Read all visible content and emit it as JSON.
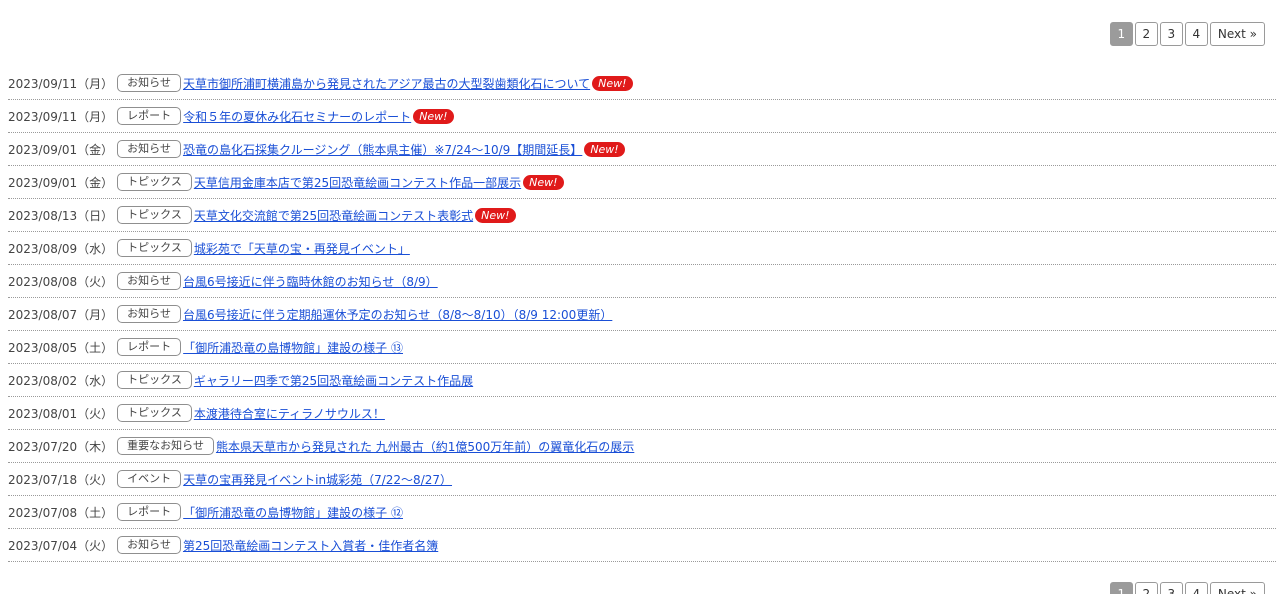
{
  "pagination": {
    "pages": [
      "1",
      "2",
      "3",
      "4"
    ],
    "current": "1",
    "next_label": "Next »"
  },
  "news": [
    {
      "date": "2023/09/11（月）",
      "category": "お知らせ",
      "title": "天草市御所浦町横浦島から発見されたアジア最古の大型裂歯類化石について",
      "is_new": true,
      "new_label": "New!"
    },
    {
      "date": "2023/09/11（月）",
      "category": "レポート",
      "title": "令和５年の夏休み化石セミナーのレポート",
      "is_new": true,
      "new_label": "New!"
    },
    {
      "date": "2023/09/01（金）",
      "category": "お知らせ",
      "title": "恐竜の島化石採集クルージング（熊本県主催）※7/24〜10/9【期間延長】",
      "is_new": true,
      "new_label": "New!"
    },
    {
      "date": "2023/09/01（金）",
      "category": "トピックス",
      "title": "天草信用金庫本店で第25回恐竜絵画コンテスト作品一部展示",
      "is_new": true,
      "new_label": "New!"
    },
    {
      "date": "2023/08/13（日）",
      "category": "トピックス",
      "title": "天草文化交流館で第25回恐竜絵画コンテスト表彰式",
      "is_new": true,
      "new_label": "New!"
    },
    {
      "date": "2023/08/09（水）",
      "category": "トピックス",
      "title": "城彩苑で「天草の宝・再発見イベント」",
      "is_new": false,
      "new_label": ""
    },
    {
      "date": "2023/08/08（火）",
      "category": "お知らせ",
      "title": "台風6号接近に伴う臨時休館のお知らせ（8/9）",
      "is_new": false,
      "new_label": ""
    },
    {
      "date": "2023/08/07（月）",
      "category": "お知らせ",
      "title": "台風6号接近に伴う定期船運休予定のお知らせ（8/8〜8/10）（8/9 12:00更新）",
      "is_new": false,
      "new_label": ""
    },
    {
      "date": "2023/08/05（土）",
      "category": "レポート",
      "title": "「御所浦恐竜の島博物館」建設の様子 ⑬",
      "is_new": false,
      "new_label": ""
    },
    {
      "date": "2023/08/02（水）",
      "category": "トピックス",
      "title": "ギャラリー四季で第25回恐竜絵画コンテスト作品展",
      "is_new": false,
      "new_label": ""
    },
    {
      "date": "2023/08/01（火）",
      "category": "トピックス",
      "title": "本渡港待合室にティラノサウルス！",
      "is_new": false,
      "new_label": ""
    },
    {
      "date": "2023/07/20（木）",
      "category": "重要なお知らせ",
      "title": "熊本県天草市から発見された 九州最古（約1億500万年前）の翼竜化石の展示",
      "is_new": false,
      "new_label": ""
    },
    {
      "date": "2023/07/18（火）",
      "category": "イベント",
      "title": "天草の宝再発見イベントin城彩苑（7/22〜8/27）",
      "is_new": false,
      "new_label": ""
    },
    {
      "date": "2023/07/08（土）",
      "category": "レポート",
      "title": "「御所浦恐竜の島博物館」建設の様子 ⑫",
      "is_new": false,
      "new_label": ""
    },
    {
      "date": "2023/07/04（火）",
      "category": "お知らせ",
      "title": "第25回恐竜絵画コンテスト入賞者・佳作者名簿",
      "is_new": false,
      "new_label": ""
    }
  ]
}
